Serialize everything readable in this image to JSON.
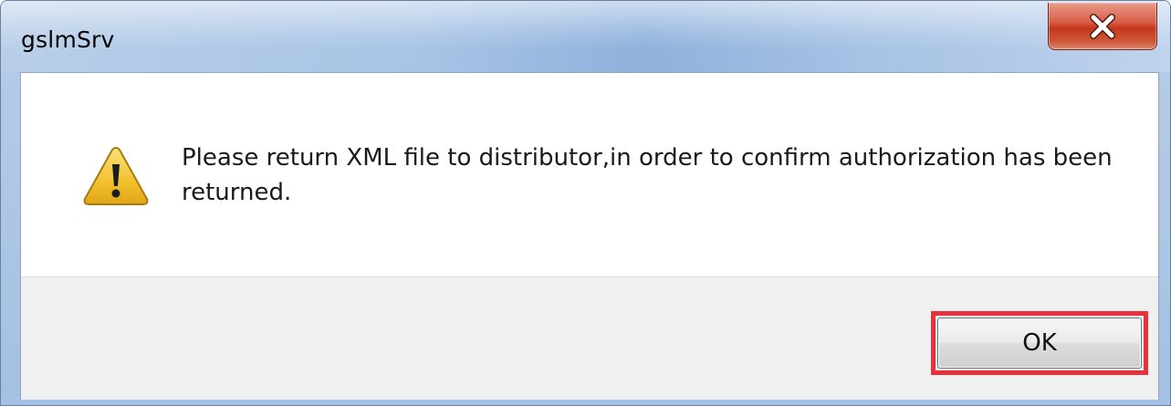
{
  "dialog": {
    "title": "gslmSrv",
    "close_icon": "close-x-icon",
    "message_icon": "warning-icon",
    "message": "Please return XML file to distributor,in order to confirm authorization has been returned.",
    "ok_label": "OK"
  },
  "colors": {
    "close_button": "#c4381d",
    "highlight": "#e8313a",
    "warning_triangle": "#f2c12e"
  }
}
